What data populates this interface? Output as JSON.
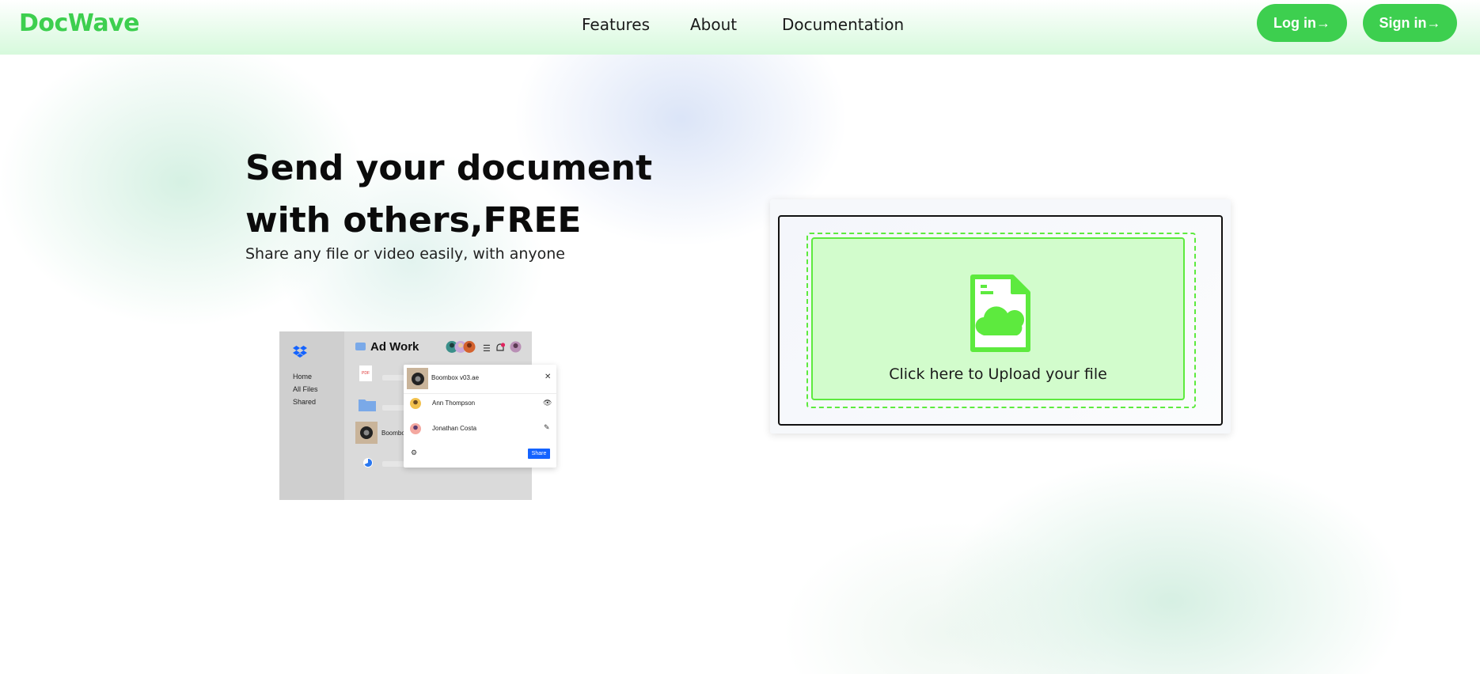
{
  "brand": {
    "name": "DocWave",
    "color": "#3dcf4f"
  },
  "nav": {
    "links": [
      {
        "label": "Features"
      },
      {
        "label": "About"
      },
      {
        "label": "Documentation"
      }
    ],
    "login_label": "Log in→",
    "signin_label": "Sign in→"
  },
  "hero": {
    "title_line1": "Send your document",
    "title_line2": "with others,FREE",
    "subtitle": "Share any file or video easily, with anyone"
  },
  "illustration": {
    "folder_title": "Ad Work",
    "sidebar_items": [
      "Home",
      "All Files",
      "Shared"
    ],
    "pdf_badge": "PDF",
    "row_file_label": "Boombo",
    "popup": {
      "file_name": "Boombox v03.ae",
      "people": [
        {
          "name": "Ann Thompson"
        },
        {
          "name": "Jonathan Costa"
        }
      ],
      "share_label": "Share"
    }
  },
  "upload": {
    "label": "Click here to Upload your file",
    "accent_color": "#5dea3e",
    "zone_color": "#d2fccc"
  }
}
